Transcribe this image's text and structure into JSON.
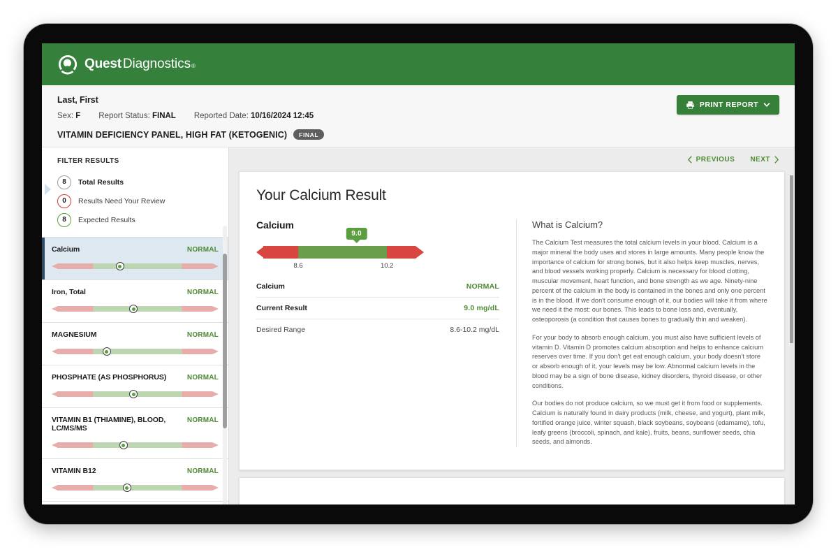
{
  "brand": {
    "name_bold": "Quest",
    "name_light": "Diagnostics",
    "registered": "®",
    "bar_color": "#35803a"
  },
  "patient": {
    "name": "Last, First",
    "sex_label": "Sex:",
    "sex_value": "F",
    "status_label": "Report Status:",
    "status_value": "FINAL",
    "reported_label": "Reported Date:",
    "reported_value": "10/16/2024 12:45",
    "panel_title": "VITAMIN DEFICIENCY PANEL, HIGH FAT (KETOGENIC)",
    "panel_status": "FINAL"
  },
  "toolbar": {
    "print_label": "PRINT REPORT"
  },
  "sidebar": {
    "filter_title": "FILTER RESULTS",
    "filters": [
      {
        "count": "8",
        "label": "Total Results",
        "tone": "grey",
        "selected": true
      },
      {
        "count": "0",
        "label": "Results Need Your Review",
        "tone": "red",
        "selected": false
      },
      {
        "count": "8",
        "label": "Expected Results",
        "tone": "green",
        "selected": false
      }
    ],
    "tests": [
      {
        "name": "Calcium",
        "status": "NORMAL",
        "marker_pct": 41,
        "selected": true
      },
      {
        "name": "Iron, Total",
        "status": "NORMAL",
        "marker_pct": 49,
        "selected": false
      },
      {
        "name": "MAGNESIUM",
        "status": "NORMAL",
        "marker_pct": 33,
        "selected": false
      },
      {
        "name": "PHOSPHATE (AS PHOSPHORUS)",
        "status": "NORMAL",
        "marker_pct": 49,
        "selected": false
      },
      {
        "name": "VITAMIN B1 (THIAMINE), BLOOD, LC/MS/MS",
        "status": "NORMAL",
        "marker_pct": 43,
        "selected": false
      },
      {
        "name": "VITAMIN B12",
        "status": "NORMAL",
        "marker_pct": 45,
        "selected": false
      }
    ]
  },
  "nav": {
    "previous": "PREVIOUS",
    "next": "NEXT"
  },
  "result": {
    "title": "Your Calcium Result",
    "analyte": "Calcium",
    "gauge": {
      "value_label": "9.0",
      "value_pct": 41,
      "low_tick": "8.6",
      "high_tick": "10.2",
      "low_tick_pct": 25,
      "high_tick_pct": 78,
      "green_color": "#6a9e4b",
      "red_color": "#d9453f"
    },
    "rows": [
      {
        "label": "Calcium",
        "value": "NORMAL",
        "label_strong": true,
        "value_ok": true
      },
      {
        "label": "Current Result",
        "value": "9.0 mg/dL",
        "label_strong": true,
        "value_ok": true
      },
      {
        "label": "Desired Range",
        "value": "8.6-10.2 mg/dL",
        "label_strong": false,
        "value_ok": false
      }
    ]
  },
  "info": {
    "heading": "What is Calcium?",
    "paragraphs": [
      "The Calcium Test measures the total calcium levels in your blood. Calcium is a major mineral the body uses and stores in large amounts. Many people know the importance of calcium for strong bones, but it also helps keep muscles, nerves, and blood vessels working properly. Calcium is necessary for blood clotting, muscular movement, heart function, and bone strength as we age. Ninety-nine percent of the calcium in the body is contained in the bones and only one percent is in the blood. If we don't consume enough of it, our bodies will take it from where we need it the most: our bones. This leads to bone loss and, eventually, osteoporosis (a condition that causes bones to gradually thin and weaken).",
      "For your body to absorb enough calcium, you must also have sufficient levels of vitamin D. Vitamin D promotes calcium absorption and helps to enhance calcium reserves over time. If you don't get eat enough calcium, your body doesn't store or absorb enough of it, your levels may be low. Abnormal calcium levels in the blood may be a sign of bone disease, kidney disorders, thyroid disease, or other conditions.",
      "Our bodies do not produce calcium, so we must get it from food or supplements. Calcium is naturally found in dairy products (milk, cheese, and yogurt), plant milk, fortified orange juice, winter squash, black soybeans, soybeans (edamame), tofu, leafy greens (broccoli, spinach, and kale), fruits, beans, sunflower seeds, chia seeds, and almonds."
    ]
  }
}
